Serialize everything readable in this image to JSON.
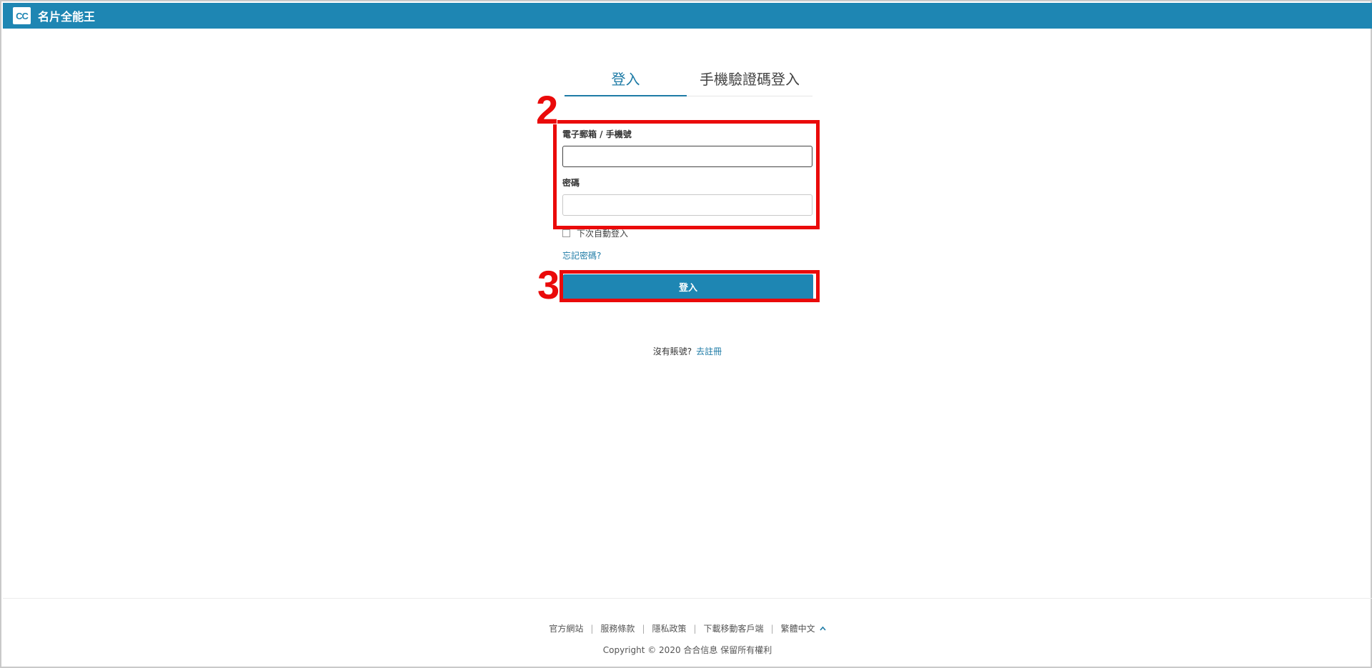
{
  "header": {
    "logo_text": "CC",
    "brand": "名片全能王",
    "bg_color": "#1e86b3"
  },
  "tabs": [
    {
      "label": "登入",
      "active": true
    },
    {
      "label": "手機驗證碼登入",
      "active": false
    }
  ],
  "form": {
    "account_label": "電子郵箱 / 手機號",
    "account_value": "",
    "password_label": "密碼",
    "password_value": "",
    "remember_label": "下次自動登入",
    "remember_checked": false,
    "forgot_label": "忘記密碼?",
    "submit_label": "登入"
  },
  "annotations": [
    {
      "number": "2",
      "color": "#ea0a0a"
    },
    {
      "number": "3",
      "color": "#ea0a0a"
    }
  ],
  "register": {
    "prompt": "沒有賬號?",
    "link": "去註冊"
  },
  "footer": {
    "links": [
      "官方網站",
      "服務條款",
      "隱私政策",
      "下載移動客戶端"
    ],
    "language": "繁體中文",
    "language_icon": "chevron-up-icon",
    "copyright": "Copyright © 2020 合合信息 保留所有權利"
  },
  "colors": {
    "accent": "#1e86b3",
    "link": "#1e7ba6",
    "annotation": "#ea0a0a"
  }
}
